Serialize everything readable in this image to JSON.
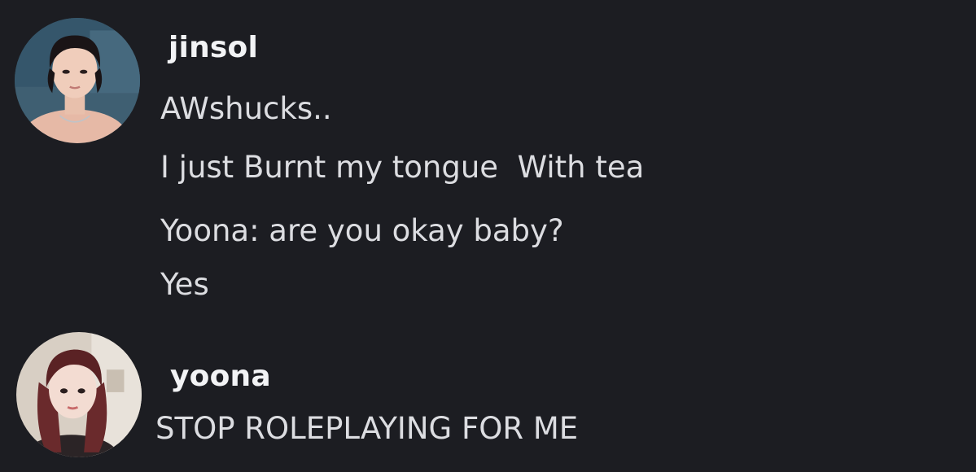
{
  "messages": [
    {
      "author": "jinsol",
      "avatar": "jinsol-avatar",
      "lines": [
        "AWshucks..",
        "I just Burnt my tongue  With tea",
        "Yoona: are you okay baby?",
        "Yes"
      ]
    },
    {
      "author": "yoona",
      "avatar": "yoona-avatar",
      "lines": [
        "STOP ROLEPLAYING FOR ME"
      ]
    }
  ],
  "colors": {
    "background": "#1c1d22",
    "username": "#f2f3f5",
    "message_text": "#dcdde1"
  }
}
